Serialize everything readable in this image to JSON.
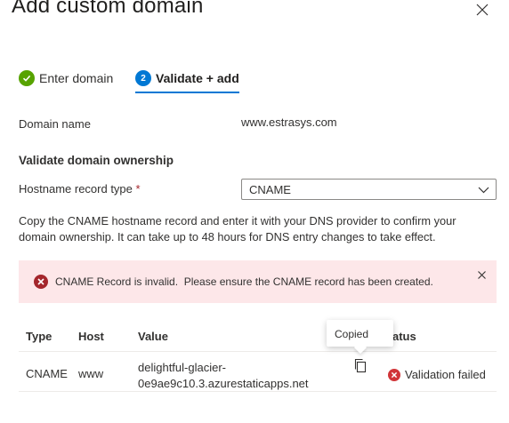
{
  "dialog": {
    "title": "Add custom domain"
  },
  "steps": [
    {
      "label": "Enter domain",
      "state": "completed"
    },
    {
      "number": "2",
      "label": "Validate + add",
      "state": "current"
    }
  ],
  "domain": {
    "label": "Domain name",
    "value": "www.estrasys.com"
  },
  "ownership": {
    "section_title": "Validate domain ownership",
    "record_type_label": "Hostname record type",
    "required_marker": "*",
    "record_type_value": "CNAME",
    "help_text": "Copy the CNAME hostname record and enter it with your DNS provider to confirm your domain ownership. It can take up to 48 hours for DNS entry changes to take effect."
  },
  "alert": {
    "message": "CNAME Record is invalid.  Please ensure the CNAME record has been created.",
    "color": "#fde7e9"
  },
  "table": {
    "headers": {
      "type": "Type",
      "host": "Host",
      "value": "Value",
      "status": "atus"
    },
    "rows": [
      {
        "type": "CNAME",
        "host": "www",
        "value_line1": "delightful-glacier-",
        "value_line2": "0e9ae9c10.3.azurestaticapps.net",
        "status": "Validation failed"
      }
    ]
  },
  "tooltip": {
    "text": "Copied"
  },
  "icons": {
    "close": "close-icon",
    "step_done": "checkmark-circle-icon",
    "error": "error-circle-icon",
    "copy": "copy-icon",
    "chevron": "chevron-down-icon"
  },
  "colors": {
    "accent": "#0078d4",
    "success": "#57a300",
    "error": "#d13438",
    "required": "#a4262c"
  }
}
